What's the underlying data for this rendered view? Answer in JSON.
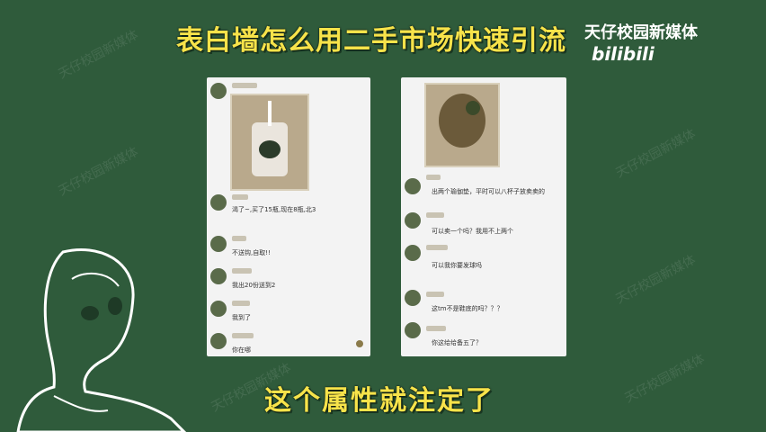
{
  "title": "表白墙怎么用二手市场快速引流",
  "brand": {
    "name": "天仔校园新媒体",
    "logo": "bilibili"
  },
  "caption": "这个属性就注定了",
  "watermark_text": "天仔校园新媒体",
  "left_phone": {
    "messages": [
      "渴了~,买了15瓶,现在8瓶,北3",
      "不送钩,自取!!",
      "我出20份送到2",
      "我到了",
      "你在哪"
    ]
  },
  "right_phone": {
    "messages": [
      "出两个瑜伽垫，平时可以八杯子放卖卖的",
      "可以卖一个吗？我用不上两个",
      "可以我你要发球吗",
      "这tm不是鞋底的吗？？？",
      "你这给给备五了？"
    ]
  },
  "colors": {
    "board": "#2f5b3b",
    "title": "#f7e34a"
  }
}
